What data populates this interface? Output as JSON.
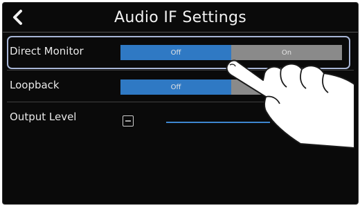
{
  "header": {
    "title": "Audio IF Settings",
    "back_icon": "chevron-left-icon"
  },
  "settings": {
    "direct_monitor": {
      "label": "Direct Monitor",
      "options": [
        "Off",
        "On"
      ],
      "selected": "Off"
    },
    "loopback": {
      "label": "Loopback",
      "options": [
        "Off",
        "On"
      ],
      "selected": "Off"
    },
    "output_level": {
      "label": "Output Level",
      "minus_icon": "minus-icon"
    }
  },
  "colors": {
    "accent": "#2f79c4",
    "inactive": "#8a8a8a",
    "highlight": "#a8b6d6"
  }
}
